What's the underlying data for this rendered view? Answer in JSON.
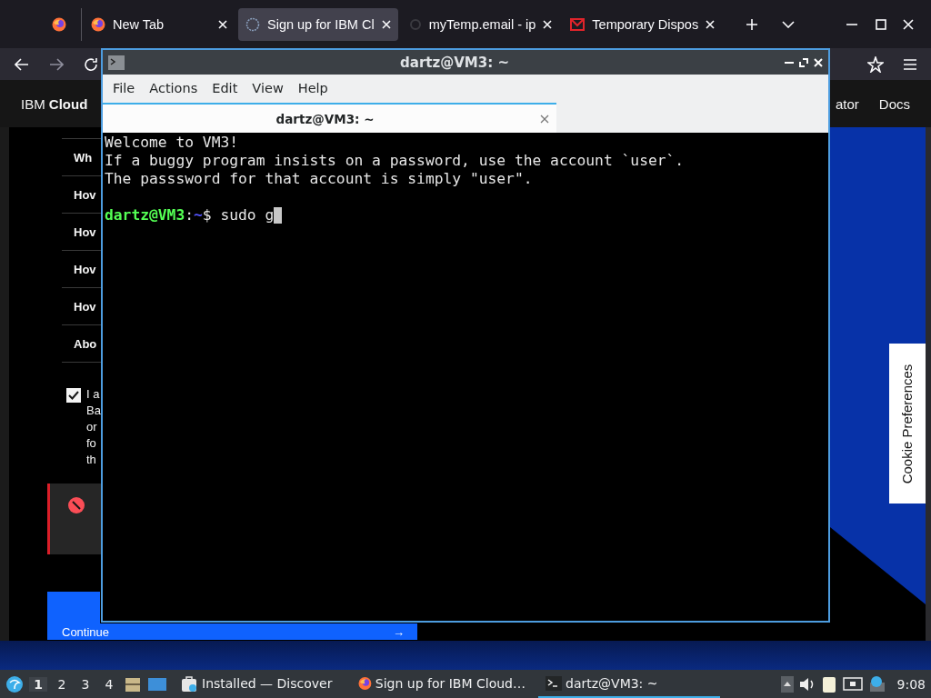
{
  "browser": {
    "tabs": [
      {
        "label": "New Tab",
        "selected": false,
        "kind": "firefox"
      },
      {
        "label": "Sign up for IBM Cl",
        "selected": true,
        "kind": "ibm"
      },
      {
        "label": "myTemp.email - ip",
        "selected": false,
        "kind": "mytemp"
      },
      {
        "label": "Temporary Dispos",
        "selected": false,
        "kind": "mail"
      }
    ],
    "header": {
      "brand": "IBM **Cloud**",
      "nav": [
        "ator",
        "Docs"
      ]
    },
    "faq": [
      "Wh",
      "Hov",
      "Hov",
      "Hov",
      "Hov",
      "Abo"
    ],
    "consent": {
      "checked": true,
      "lines": [
        "I a",
        "Ba",
        "or",
        "fo",
        "th"
      ]
    },
    "continue": {
      "label": "Continue",
      "arrow": "→"
    },
    "cookie_tab": "Cookie Preferences"
  },
  "terminal": {
    "title": "dartz@VM3: ~",
    "menu": [
      "File",
      "Actions",
      "Edit",
      "View",
      "Help"
    ],
    "tab": "dartz@VM3: ~",
    "output": [
      "Welcome to VM3!",
      "If a buggy program insists on a password, use the account `user`.",
      "The passsword for that account is simply \"user\"."
    ],
    "prompt": {
      "user_host": "dartz@VM3",
      "separator": ":",
      "path": "~",
      "command": "$ sudo g"
    }
  },
  "taskbar": {
    "workspaces": [
      {
        "label": "1",
        "selected": true
      },
      {
        "label": "2",
        "selected": false
      },
      {
        "label": "3",
        "selected": false
      },
      {
        "label": "4",
        "selected": false
      }
    ],
    "tasks": [
      {
        "label": "Installed — Discover",
        "selected": false,
        "kind": "discover"
      },
      {
        "label": "Sign up for IBM Cloud…",
        "selected": false,
        "kind": "firefox"
      },
      {
        "label": "dartz@VM3: ~",
        "selected": true,
        "kind": "terminal"
      }
    ],
    "clock": "9:08"
  }
}
